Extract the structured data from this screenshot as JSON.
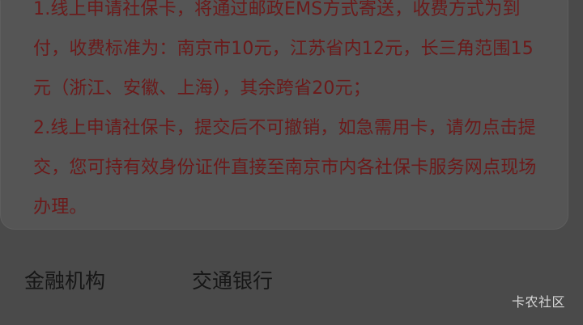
{
  "notice": {
    "item1": "1.线上申请社保卡，将通过邮政EMS方式寄送，收费方式为到付，收费标准为：南京市10元，江苏省内12元，长三角范围15元（浙江、安徽、上海），其余跨省20元；",
    "item2": "2.线上申请社保卡，提交后不可撤销，如急需用卡，请勿点击提交，您可持有效身份证件直接至南京市内各社保卡服务网点现场办理。"
  },
  "fields": [
    {
      "label": "金融机构",
      "value": "交通银行"
    }
  ],
  "watermark": "卡农社区"
}
